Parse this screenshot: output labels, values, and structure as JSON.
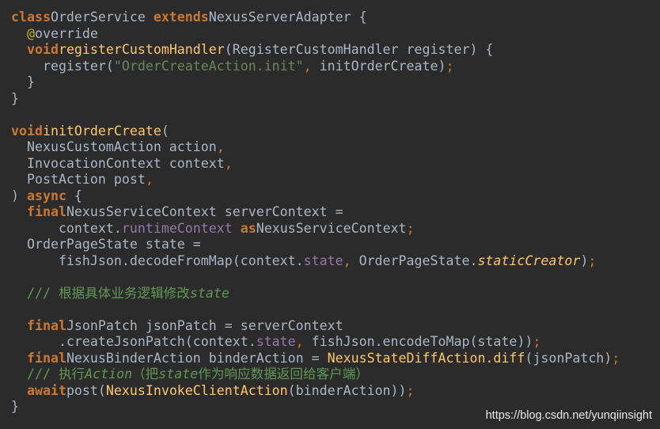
{
  "editor": {
    "watermark": "https://blog.csdn.net/yunqiinsight",
    "colors": {
      "background": "#2b2b2b",
      "plain": "#a9b7c6",
      "keyword": "#cc7832",
      "function": "#ffc66d",
      "string": "#6a8759",
      "field": "#9876aa",
      "comment": "#629755",
      "annotation": "#bbb529"
    },
    "lines": [
      [
        [
          "kw",
          "class"
        ],
        [
          "",
          "OrderService "
        ],
        [
          "kw",
          "extends"
        ],
        [
          "",
          "NexusServerAdapter {"
        ]
      ],
      [
        [
          "",
          "  "
        ],
        [
          "anno",
          "@"
        ],
        [
          "",
          "override"
        ]
      ],
      [
        [
          "",
          "  "
        ],
        [
          "kw",
          "void"
        ],
        [
          "fn",
          "registerCustomHandler"
        ],
        [
          "",
          "(RegisterCustomHandler register) {"
        ]
      ],
      [
        [
          "",
          "    register("
        ],
        [
          "str",
          "\"OrderCreateAction.init\""
        ],
        [
          "punct",
          ", "
        ],
        [
          "",
          "initOrderCreate)"
        ],
        [
          "punct",
          ";"
        ]
      ],
      [
        [
          "",
          "  }"
        ]
      ],
      [
        [
          "",
          "}"
        ]
      ],
      [
        [
          "",
          ""
        ]
      ],
      [
        [
          "kw",
          "void"
        ],
        [
          "fn",
          "initOrderCreate"
        ],
        [
          "",
          "("
        ]
      ],
      [
        [
          "",
          "  NexusCustomAction action"
        ],
        [
          "punct",
          ","
        ]
      ],
      [
        [
          "",
          "  InvocationContext context"
        ],
        [
          "punct",
          ","
        ]
      ],
      [
        [
          "",
          "  PostAction post"
        ],
        [
          "punct",
          ","
        ]
      ],
      [
        [
          "",
          ") "
        ],
        [
          "kw",
          "async"
        ],
        [
          "",
          " {"
        ]
      ],
      [
        [
          "",
          "  "
        ],
        [
          "kw",
          "final"
        ],
        [
          "",
          "NexusServiceContext serverContext ="
        ]
      ],
      [
        [
          "",
          "      context."
        ],
        [
          "field",
          "runtimeContext"
        ],
        [
          "kw",
          " as"
        ],
        [
          "",
          "NexusServiceContext"
        ],
        [
          "punct",
          ";"
        ]
      ],
      [
        [
          "",
          "  OrderPageState state ="
        ]
      ],
      [
        [
          "",
          "      fishJson.decodeFromMap(context."
        ],
        [
          "field",
          "state"
        ],
        [
          "punct",
          ", "
        ],
        [
          "",
          "OrderPageState."
        ],
        [
          "italic-fn",
          "staticCreator"
        ],
        [
          "",
          ")"
        ],
        [
          "punct",
          ";"
        ]
      ],
      [
        [
          "",
          ""
        ]
      ],
      [
        [
          "",
          "  "
        ],
        [
          "cmt",
          "/// 根据具体业务逻辑修改"
        ],
        [
          "cmt-i",
          "state"
        ]
      ],
      [
        [
          "",
          ""
        ]
      ],
      [
        [
          "",
          "  "
        ],
        [
          "kw",
          "final"
        ],
        [
          "",
          "JsonPatch jsonPatch = serverContext"
        ]
      ],
      [
        [
          "",
          "      .createJsonPatch(context."
        ],
        [
          "field",
          "state"
        ],
        [
          "punct",
          ", "
        ],
        [
          "",
          "fishJson.encodeToMap(state))"
        ],
        [
          "punct",
          ";"
        ]
      ],
      [
        [
          "",
          "  "
        ],
        [
          "kw",
          "final"
        ],
        [
          "",
          "NexusBinderAction binderAction = "
        ],
        [
          "fn",
          "NexusStateDiffAction.diff"
        ],
        [
          "",
          "(jsonPatch)"
        ],
        [
          "punct",
          ";"
        ]
      ],
      [
        [
          "",
          "  "
        ],
        [
          "cmt",
          "/// 执行"
        ],
        [
          "cmt-i",
          "Action"
        ],
        [
          "cmt",
          "（把"
        ],
        [
          "cmt-i",
          "state"
        ],
        [
          "cmt",
          "作为响应数据返回给客户端）"
        ]
      ],
      [
        [
          "",
          "  "
        ],
        [
          "kw",
          "await"
        ],
        [
          "",
          "post("
        ],
        [
          "fn",
          "NexusInvokeClientAction"
        ],
        [
          "",
          "(binderAction))"
        ],
        [
          "punct",
          ";"
        ]
      ],
      [
        [
          "",
          "}"
        ]
      ]
    ]
  }
}
